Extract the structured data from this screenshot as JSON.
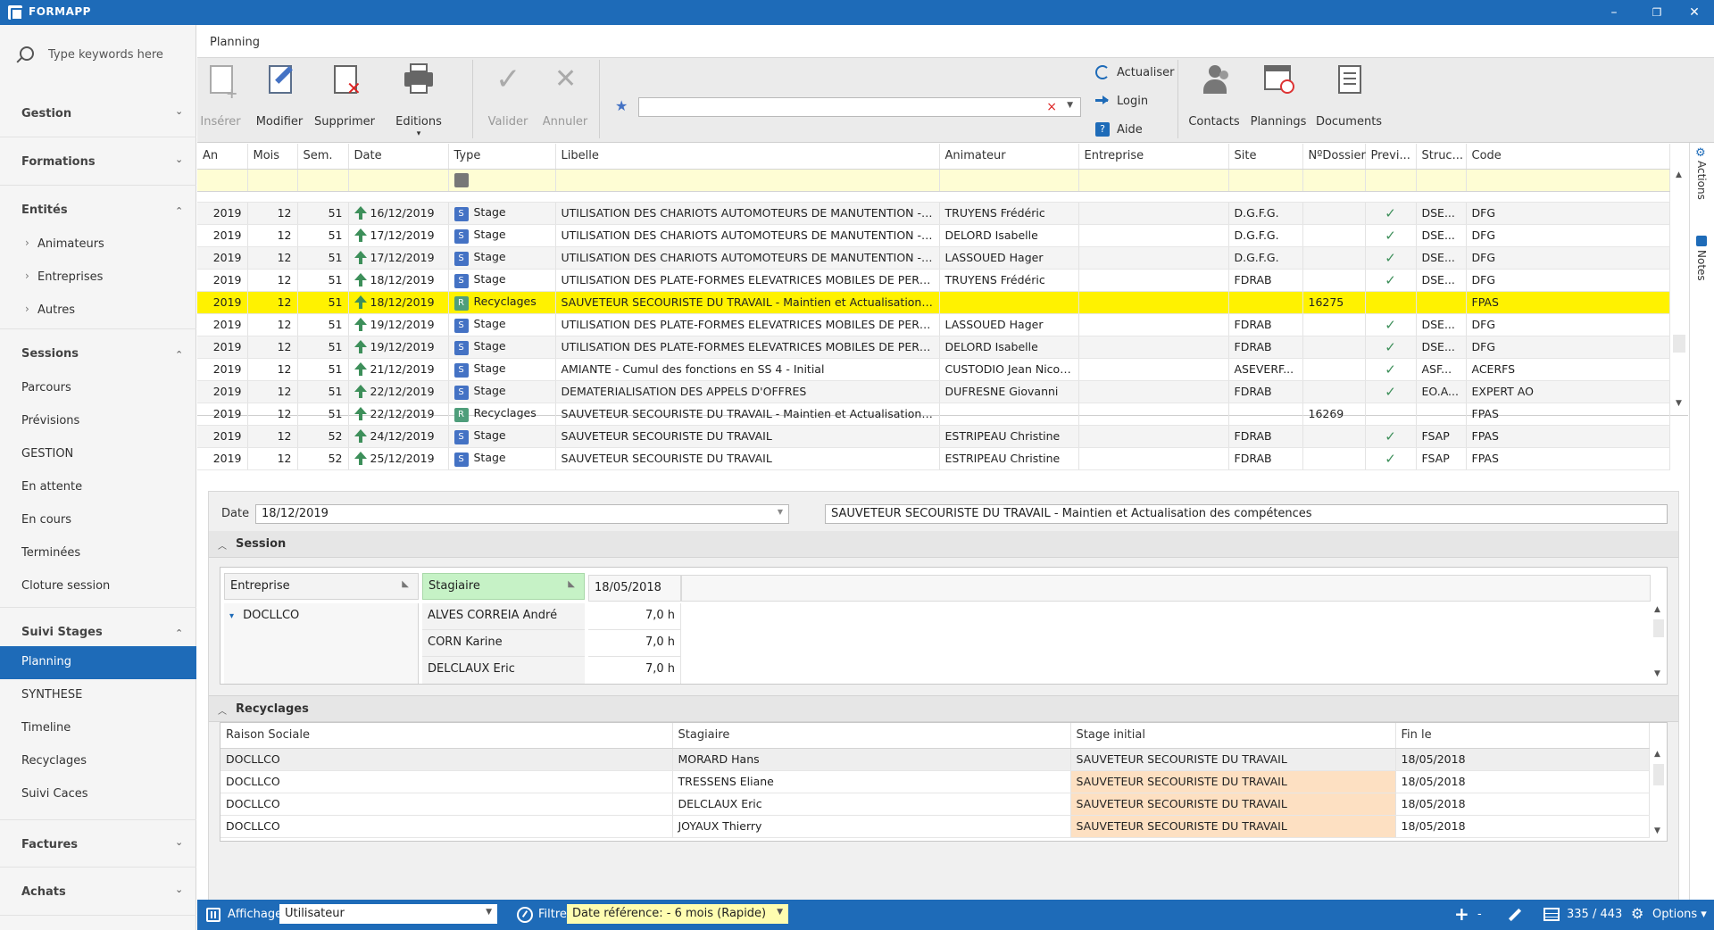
{
  "app": {
    "title": "FORMAPP",
    "win_min": "–",
    "win_restore": "❐",
    "win_close": "✕"
  },
  "sidebar": {
    "search_placeholder": "Type keywords here",
    "groups": [
      {
        "label": "Gestion",
        "chev": "⌄"
      },
      {
        "label": "Formations",
        "chev": "⌄"
      },
      {
        "label": "Entités",
        "chev": "⌃"
      },
      {
        "label": "Sessions",
        "chev": "⌃"
      },
      {
        "label": "Suivi Stages",
        "chev": "⌃"
      },
      {
        "label": "Factures",
        "chev": "⌄"
      },
      {
        "label": "Achats",
        "chev": "⌄"
      }
    ],
    "entites_items": [
      "Animateurs",
      "Entreprises",
      "Autres"
    ],
    "sessions_items": [
      "Parcours",
      "Prévisions",
      "GESTION",
      "En attente",
      "En cours",
      "Terminées",
      "Cloture session"
    ],
    "suivi_items": [
      "Planning",
      "SYNTHESE",
      "Timeline",
      "Recyclages",
      "Suivi Caces"
    ]
  },
  "main": {
    "tab_title": "Planning",
    "ribbon": {
      "inserer": "Insérer",
      "modifier": "Modifier",
      "supprimer": "Supprimer",
      "editions": "Editions",
      "editions_caret": "▾",
      "valider": "Valider",
      "annuler": "Annuler",
      "actualiser": "Actualiser",
      "login": "Login",
      "aide": "Aide",
      "contacts": "Contacts",
      "plannings": "Plannings",
      "documents": "Documents",
      "star": "★",
      "filter_clear": "×",
      "filter_dd": "▼"
    }
  },
  "grid": {
    "columns": [
      "An",
      "Mois",
      "Sem.",
      "Date",
      "Type",
      "Libelle",
      "Animateur",
      "Entreprise",
      "Site",
      "NºDossier",
      "Previ...",
      "Struc...",
      "Code"
    ],
    "rows": [
      {
        "an": "2019",
        "mois": "12",
        "sem": "51",
        "date": "16/12/2019",
        "badge": "S",
        "type": "Stage",
        "libelle": "UTILISATION DES CHARIOTS AUTOMOTEURS DE MANUTENTION - Cat...",
        "animateur": "TRUYENS Frédéric",
        "entreprise": "",
        "site": "D.G.F.G.",
        "dossier": "",
        "previ": "✓",
        "struc": "DSE...",
        "code": "DFG"
      },
      {
        "an": "2019",
        "mois": "12",
        "sem": "51",
        "date": "17/12/2019",
        "badge": "S",
        "type": "Stage",
        "libelle": "UTILISATION DES CHARIOTS AUTOMOTEURS DE MANUTENTION - Cat...",
        "animateur": "DELORD Isabelle",
        "entreprise": "",
        "site": "D.G.F.G.",
        "dossier": "",
        "previ": "✓",
        "struc": "DSE...",
        "code": "DFG"
      },
      {
        "an": "2019",
        "mois": "12",
        "sem": "51",
        "date": "17/12/2019",
        "badge": "S",
        "type": "Stage",
        "libelle": "UTILISATION DES CHARIOTS AUTOMOTEURS DE MANUTENTION - Cat...",
        "animateur": "LASSOUED Hager",
        "entreprise": "",
        "site": "D.G.F.G.",
        "dossier": "",
        "previ": "✓",
        "struc": "DSE...",
        "code": "DFG"
      },
      {
        "an": "2019",
        "mois": "12",
        "sem": "51",
        "date": "18/12/2019",
        "badge": "S",
        "type": "Stage",
        "libelle": "UTILISATION DES PLATE-FORMES ELEVATRICES MOBILES DE PERSON...",
        "animateur": "TRUYENS Frédéric",
        "entreprise": "",
        "site": "FDRAB",
        "dossier": "",
        "previ": "✓",
        "struc": "DSE...",
        "code": "DFG"
      },
      {
        "an": "2019",
        "mois": "12",
        "sem": "51",
        "date": "18/12/2019",
        "badge": "R",
        "type": "Recyclages",
        "libelle": "SAUVETEUR SECOURISTE DU TRAVAIL - Maintien et Actualisation des...",
        "animateur": "",
        "entreprise": "",
        "site": "",
        "dossier": "16275",
        "previ": "",
        "struc": "",
        "code": "FPAS"
      },
      {
        "an": "2019",
        "mois": "12",
        "sem": "51",
        "date": "19/12/2019",
        "badge": "S",
        "type": "Stage",
        "libelle": "UTILISATION DES PLATE-FORMES ELEVATRICES MOBILES DE PERSON...",
        "animateur": "LASSOUED Hager",
        "entreprise": "",
        "site": "FDRAB",
        "dossier": "",
        "previ": "✓",
        "struc": "DSE...",
        "code": "DFG"
      },
      {
        "an": "2019",
        "mois": "12",
        "sem": "51",
        "date": "19/12/2019",
        "badge": "S",
        "type": "Stage",
        "libelle": "UTILISATION DES PLATE-FORMES ELEVATRICES MOBILES DE PERSON...",
        "animateur": "DELORD Isabelle",
        "entreprise": "",
        "site": "FDRAB",
        "dossier": "",
        "previ": "✓",
        "struc": "DSE...",
        "code": "DFG"
      },
      {
        "an": "2019",
        "mois": "12",
        "sem": "51",
        "date": "21/12/2019",
        "badge": "S",
        "type": "Stage",
        "libelle": "AMIANTE - Cumul des fonctions en SS 4 - Initial",
        "animateur": "CUSTODIO Jean Nicolas",
        "entreprise": "",
        "site": "ASEVERF...",
        "dossier": "",
        "previ": "✓",
        "struc": "ASF...",
        "code": "ACERFS"
      },
      {
        "an": "2019",
        "mois": "12",
        "sem": "51",
        "date": "22/12/2019",
        "badge": "S",
        "type": "Stage",
        "libelle": "DEMATERIALISATION DES APPELS D'OFFRES",
        "animateur": "DUFRESNE Giovanni",
        "entreprise": "",
        "site": "FDRAB",
        "dossier": "",
        "previ": "✓",
        "struc": "EO.A...",
        "code": "EXPERT AO"
      },
      {
        "an": "2019",
        "mois": "12",
        "sem": "51",
        "date": "22/12/2019",
        "badge": "R",
        "type": "Recyclages",
        "libelle": "SAUVETEUR SECOURISTE DU TRAVAIL - Maintien et Actualisation des...",
        "animateur": "",
        "entreprise": "",
        "site": "",
        "dossier": "16269",
        "previ": "",
        "struc": "",
        "code": "FPAS"
      },
      {
        "an": "2019",
        "mois": "12",
        "sem": "52",
        "date": "24/12/2019",
        "badge": "S",
        "type": "Stage",
        "libelle": "SAUVETEUR SECOURISTE DU TRAVAIL",
        "animateur": "ESTRIPEAU Christine",
        "entreprise": "",
        "site": "FDRAB",
        "dossier": "",
        "previ": "✓",
        "struc": "FSAP",
        "code": "FPAS"
      },
      {
        "an": "2019",
        "mois": "12",
        "sem": "52",
        "date": "25/12/2019",
        "badge": "S",
        "type": "Stage",
        "libelle": "SAUVETEUR SECOURISTE DU TRAVAIL",
        "animateur": "ESTRIPEAU Christine",
        "entreprise": "",
        "site": "FDRAB",
        "dossier": "",
        "previ": "✓",
        "struc": "FSAP",
        "code": "FPAS"
      }
    ]
  },
  "siderail": {
    "actions": "Actions",
    "notes": "Notes"
  },
  "detail": {
    "date_label": "Date",
    "date_value": "18/12/2019",
    "title_value": "SAUVETEUR SECOURISTE DU TRAVAIL - Maintien et Actualisation des compétences",
    "session_title": "Session",
    "pivot": {
      "entreprise_header": "Entreprise",
      "stagiaire_header": "Stagiaire",
      "date_col": "18/05/2018",
      "company": "DOCLLCO",
      "rows": [
        {
          "name": "ALVES CORREIA André",
          "hours": "7,0 h"
        },
        {
          "name": "CORN Karine",
          "hours": "7,0 h"
        },
        {
          "name": "DELCLAUX Eric",
          "hours": "7,0 h"
        }
      ]
    },
    "recyclages_title": "Recyclages",
    "recyclages": {
      "columns": [
        "Raison Sociale",
        "Stagiaire",
        "Stage initial",
        "Fin le"
      ],
      "rows": [
        {
          "raison": "DOCLLCO",
          "stagiaire": "MORARD Hans",
          "stage": "SAUVETEUR SECOURISTE DU TRAVAIL",
          "fin": "18/05/2018"
        },
        {
          "raison": "DOCLLCO",
          "stagiaire": "TRESSENS Eliane",
          "stage": "SAUVETEUR SECOURISTE DU TRAVAIL",
          "fin": "18/05/2018"
        },
        {
          "raison": "DOCLLCO",
          "stagiaire": "DELCLAUX Eric",
          "stage": "SAUVETEUR SECOURISTE DU TRAVAIL",
          "fin": "18/05/2018"
        },
        {
          "raison": "DOCLLCO",
          "stagiaire": "JOYAUX Thierry",
          "stage": "SAUVETEUR SECOURISTE DU TRAVAIL",
          "fin": "18/05/2018"
        }
      ]
    }
  },
  "statusbar": {
    "affichage_label": "Affichage",
    "affichage_value": "Utilisateur",
    "filtre_label": "Filtre",
    "filtre_value": "Date référence: - 6 mois (Rapide)",
    "add": "+",
    "remove": "-",
    "count": "335 / 443",
    "options": "Options ▾"
  },
  "colors": {
    "accent": "#1e6bb8",
    "highlight": "#fff200",
    "peach": "#fde0c2",
    "filter_row": "#fefdd4",
    "green": "#3d8f5a"
  }
}
